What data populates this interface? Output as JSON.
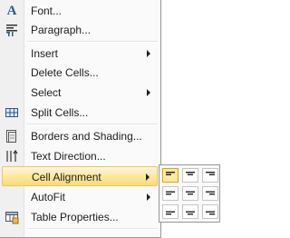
{
  "menu": {
    "items": [
      {
        "label": "Font...",
        "icon": "font-icon"
      },
      {
        "label": "Paragraph...",
        "icon": "paragraph-icon"
      },
      {
        "label": "Insert",
        "submenu": true
      },
      {
        "label": "Delete Cells..."
      },
      {
        "label": "Select",
        "submenu": true
      },
      {
        "label": "Split Cells...",
        "icon": "split-cells-icon"
      },
      {
        "label": "Borders and Shading...",
        "icon": "borders-shading-icon"
      },
      {
        "label": "Text Direction...",
        "icon": "text-direction-icon"
      },
      {
        "label": "Cell Alignment",
        "submenu": true,
        "highlighted": true
      },
      {
        "label": "AutoFit",
        "submenu": true
      },
      {
        "label": "Table Properties...",
        "icon": "table-properties-icon"
      }
    ]
  },
  "cell_alignment_submenu": {
    "options": [
      {
        "name": "align-top-left",
        "selected": true
      },
      {
        "name": "align-top-center"
      },
      {
        "name": "align-top-right"
      },
      {
        "name": "align-middle-left"
      },
      {
        "name": "align-middle-center"
      },
      {
        "name": "align-middle-right"
      },
      {
        "name": "align-bottom-left"
      },
      {
        "name": "align-bottom-center"
      },
      {
        "name": "align-bottom-right"
      }
    ]
  },
  "colors": {
    "highlight": "#fde79a",
    "highlight_border": "#e8c56b",
    "icon_blue": "#2b5797"
  }
}
